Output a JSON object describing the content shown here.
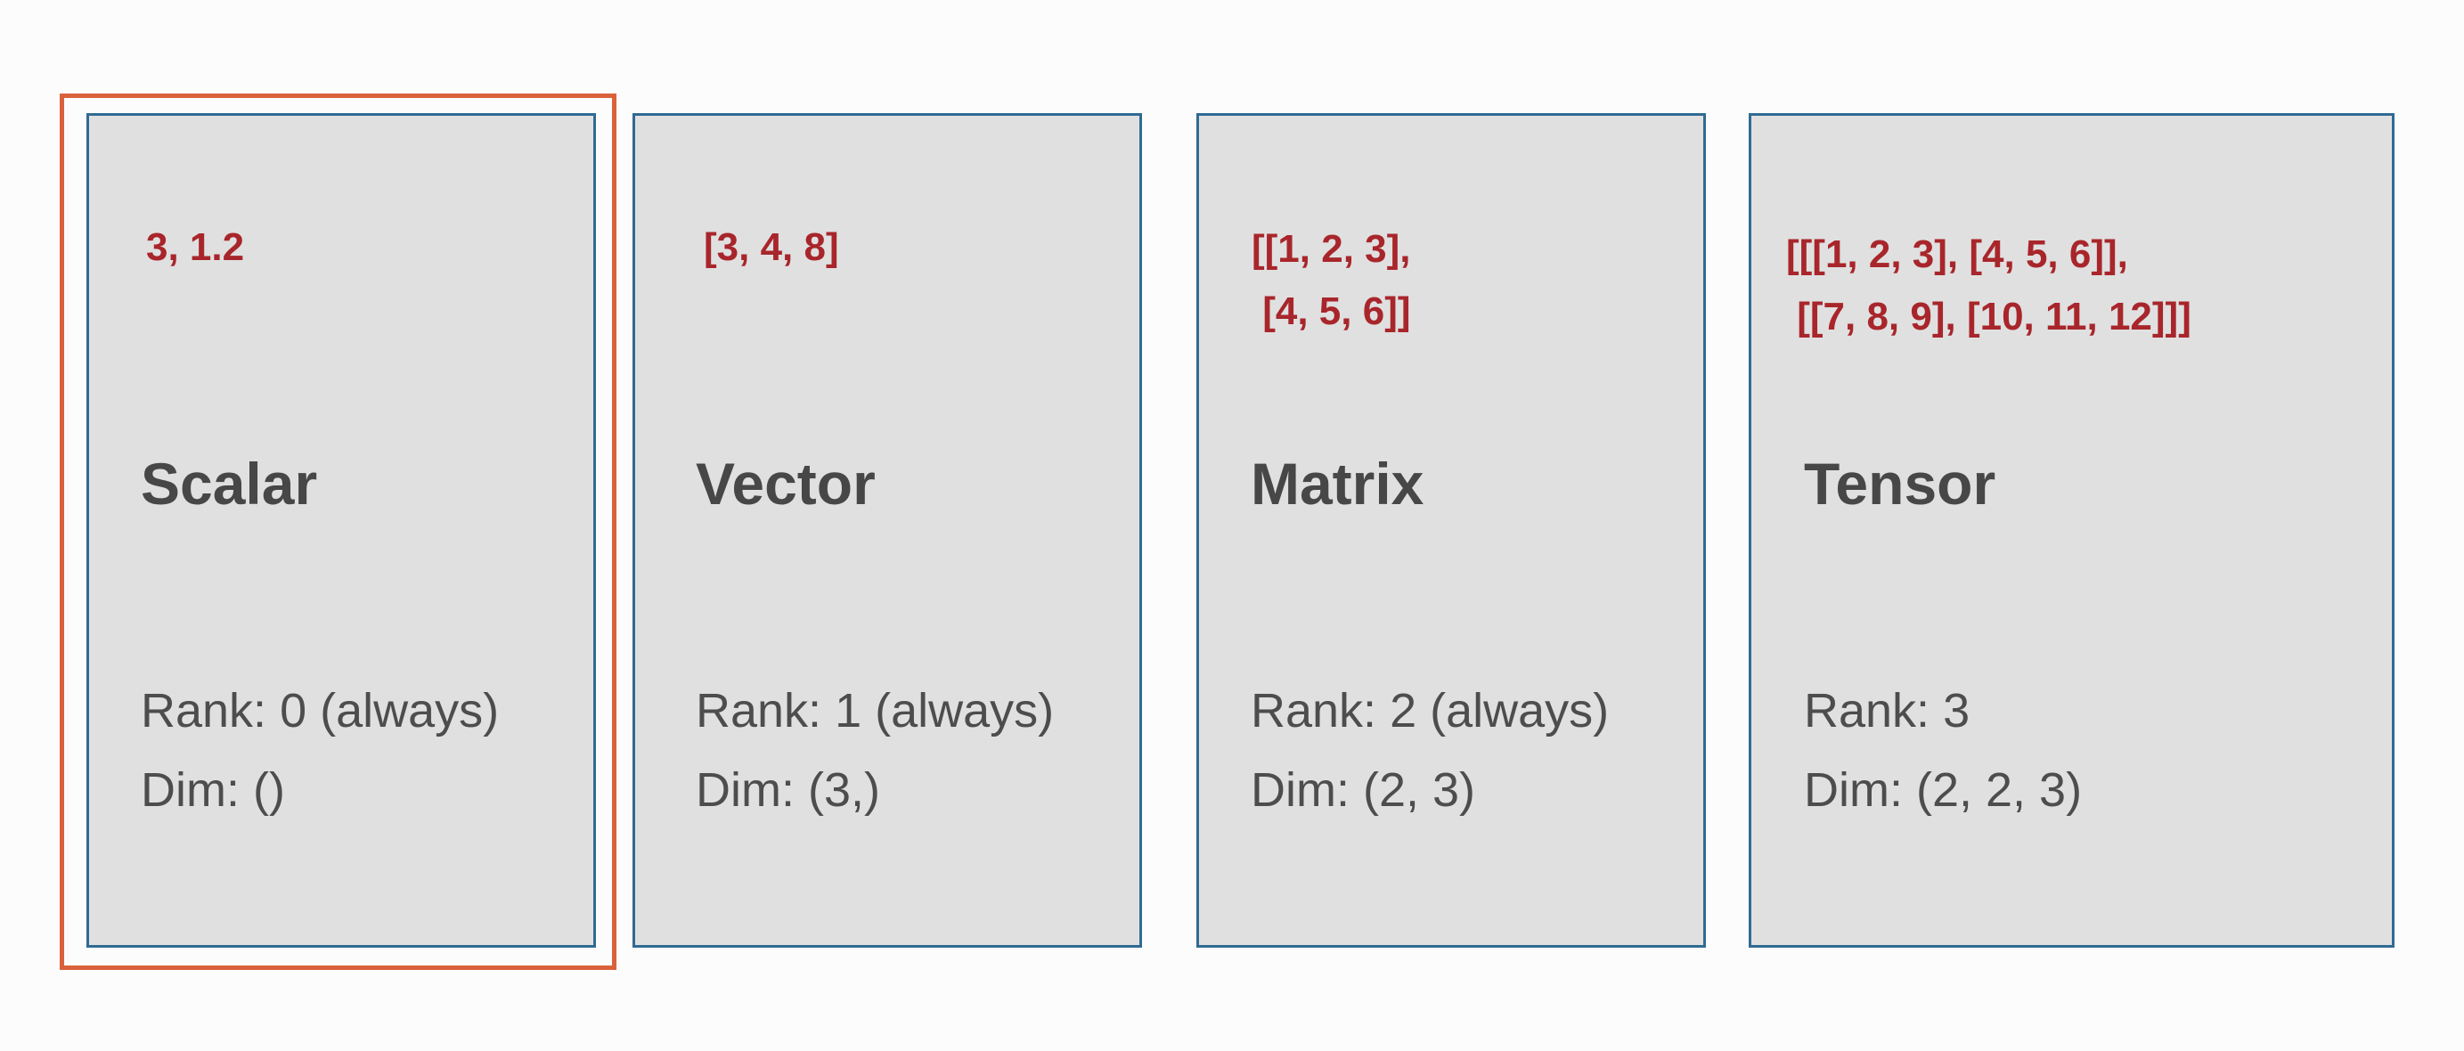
{
  "colors": {
    "background": "#fcfcfd",
    "card_fill": "#e0e0e0",
    "card_border": "#2f6b93",
    "highlight_border": "#d9623b",
    "example_text": "#a8262b",
    "name_text": "#474747",
    "detail_text": "#4d4d4d"
  },
  "highlighted_card": "scalar",
  "cards": [
    {
      "id": "scalar",
      "example": "3, 1.2",
      "name": "Scalar",
      "rank": "Rank: 0 (always)",
      "dim": "Dim: ()"
    },
    {
      "id": "vector",
      "example": "[3, 4, 8]",
      "name": "Vector",
      "rank": "Rank: 1 (always)",
      "dim": "Dim: (3,)"
    },
    {
      "id": "matrix",
      "example": "[[1, 2, 3],\n [4, 5, 6]]",
      "name": "Matrix",
      "rank": "Rank: 2 (always)",
      "dim": "Dim: (2, 3)"
    },
    {
      "id": "tensor",
      "example": "[[[1, 2, 3], [4, 5, 6]],\n [[7, 8, 9], [10, 11, 12]]]",
      "name": "Tensor",
      "rank": "Rank: 3",
      "dim": "Dim: (2, 2, 3)"
    }
  ]
}
